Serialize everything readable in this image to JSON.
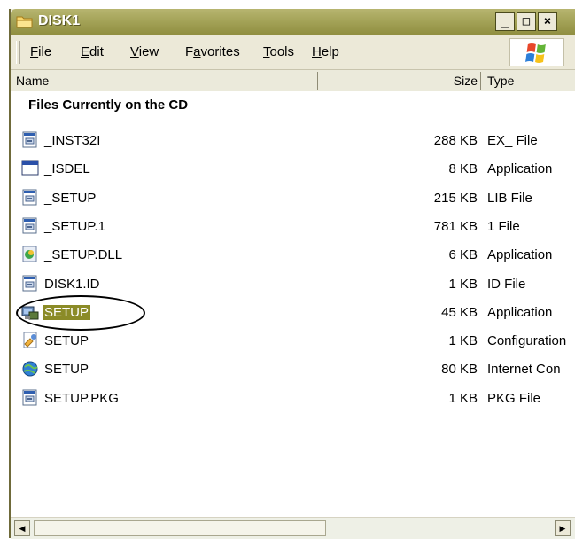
{
  "window": {
    "title": "DISK1",
    "controls": {
      "minimize": "_",
      "maximize": "□",
      "close": "×"
    }
  },
  "menu": {
    "items": [
      {
        "label": "File",
        "mnemonic": "F"
      },
      {
        "label": "Edit",
        "mnemonic": "E"
      },
      {
        "label": "View",
        "mnemonic": "V"
      },
      {
        "label": "Favorites",
        "mnemonic": "a"
      },
      {
        "label": "Tools",
        "mnemonic": "T"
      },
      {
        "label": "Help",
        "mnemonic": "H"
      }
    ]
  },
  "columns": {
    "name": "Name",
    "size": "Size",
    "type": "Type"
  },
  "group_header": "Files Currently on the CD",
  "files": [
    {
      "name": "_INST32I",
      "size": "288 KB",
      "type": "EX_ File",
      "icon": "generic-file-icon"
    },
    {
      "name": "_ISDEL",
      "size": "8 KB",
      "type": "Application",
      "icon": "window-app-icon"
    },
    {
      "name": "_SETUP",
      "size": "215 KB",
      "type": "LIB File",
      "icon": "generic-file-icon"
    },
    {
      "name": "_SETUP.1",
      "size": "781 KB",
      "type": "1 File",
      "icon": "generic-file-icon"
    },
    {
      "name": "_SETUP.DLL",
      "size": "6 KB",
      "type": "Application",
      "icon": "dll-icon"
    },
    {
      "name": "DISK1.ID",
      "size": "1 KB",
      "type": "ID File",
      "icon": "generic-file-icon"
    },
    {
      "name": "SETUP",
      "size": "45 KB",
      "type": "Application",
      "icon": "setup-app-icon",
      "selected": true
    },
    {
      "name": "SETUP",
      "size": "1 KB",
      "type": "Configuration",
      "icon": "config-file-icon"
    },
    {
      "name": "SETUP",
      "size": "80 KB",
      "type": "Internet Con",
      "icon": "internet-shortcut-icon"
    },
    {
      "name": "SETUP.PKG",
      "size": "1 KB",
      "type": "PKG File",
      "icon": "generic-file-icon"
    }
  ],
  "colors": {
    "titlebar": "#a4a358",
    "selection": "#8b8b27",
    "chrome": "#ece9d8"
  }
}
